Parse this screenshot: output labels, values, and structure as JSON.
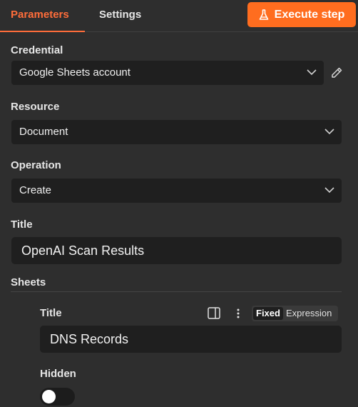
{
  "tabs": {
    "parameters": "Parameters",
    "settings": "Settings"
  },
  "execute_button": {
    "label": "Execute step",
    "icon": "flask-icon"
  },
  "credential": {
    "label": "Credential",
    "value": "Google Sheets account"
  },
  "resource": {
    "label": "Resource",
    "value": "Document"
  },
  "operation": {
    "label": "Operation",
    "value": "Create"
  },
  "title": {
    "label": "Title",
    "value": "OpenAI Scan Results"
  },
  "sheets": {
    "label": "Sheets",
    "item": {
      "title_label": "Title",
      "title_value": "DNS Records",
      "mode_fixed": "Fixed",
      "mode_expression": "Expression",
      "hidden_label": "Hidden",
      "hidden_on": false
    }
  },
  "colors": {
    "accent": "#ff6d3a",
    "button": "#ff6d1f",
    "panel": "#2e2e2e",
    "field": "#1f1f1f"
  }
}
